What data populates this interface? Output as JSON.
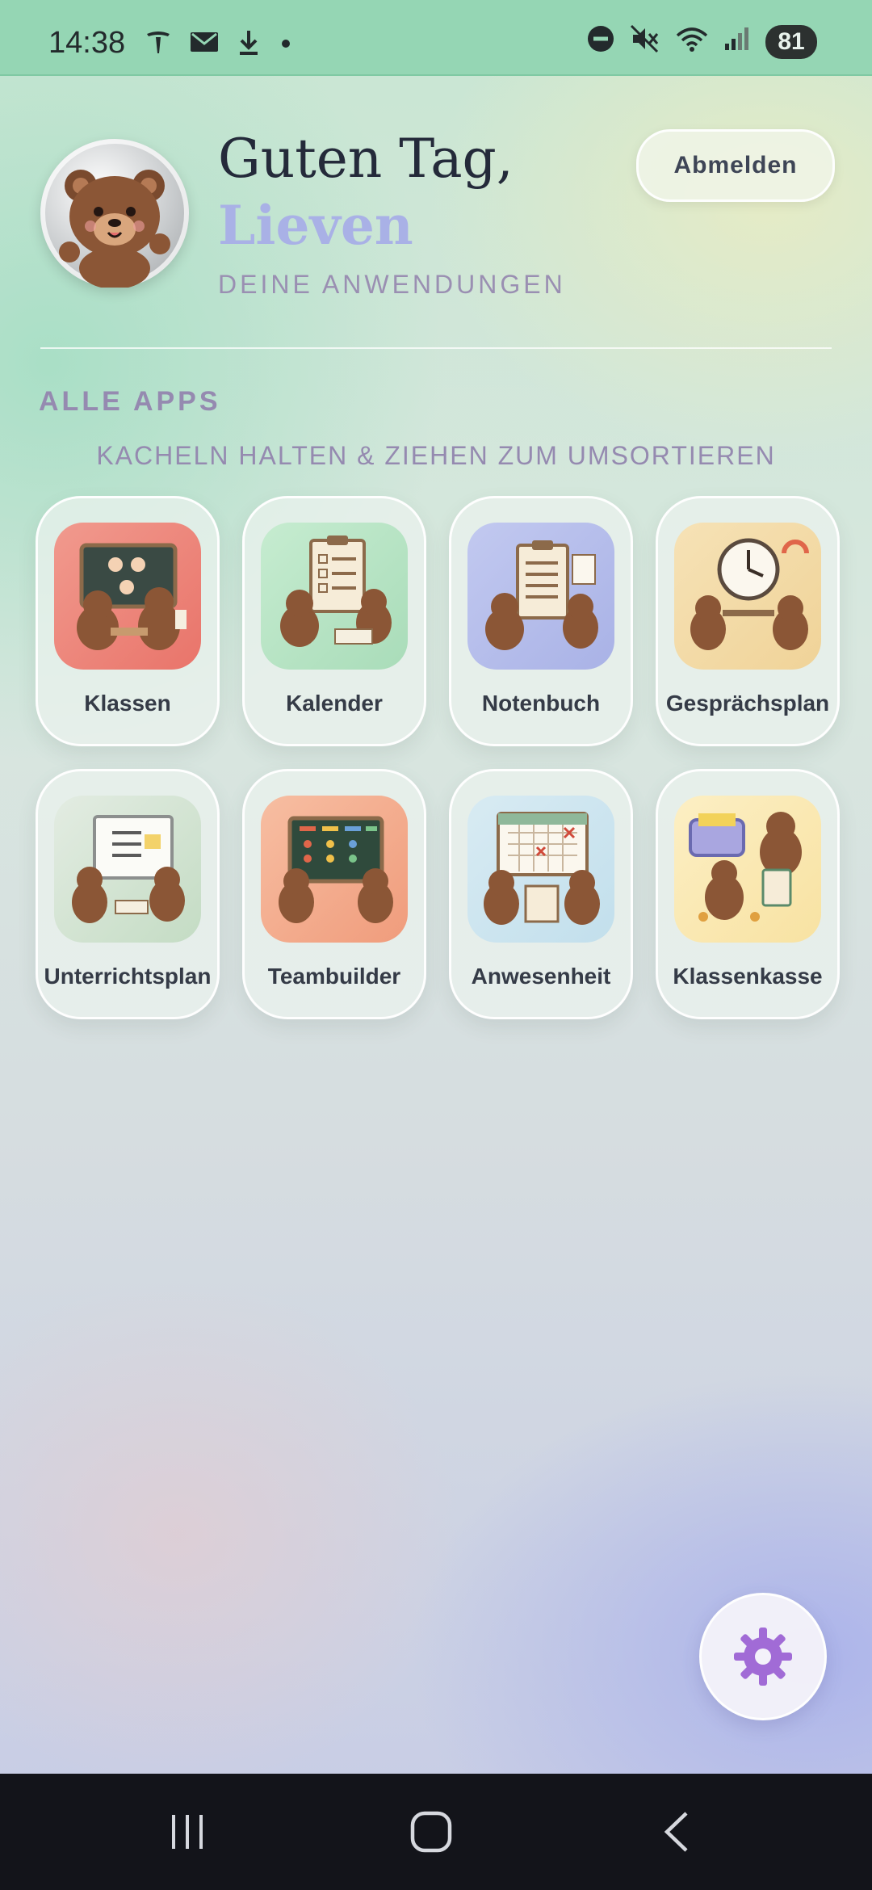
{
  "status_bar": {
    "time": "14:38",
    "battery": "81",
    "left_icons": [
      "tesla-icon",
      "mail-icon",
      "download-icon",
      "dot-icon"
    ],
    "right_icons": [
      "do-not-disturb-icon",
      "mute-icon",
      "wifi-icon",
      "signal-icon"
    ]
  },
  "header": {
    "greeting": "Guten Tag,",
    "username": "Lieven",
    "subtitle": "DEINE ANWENDUNGEN",
    "logout_label": "Abmelden"
  },
  "apps_section": {
    "title": "ALLE APPS",
    "hint": "KACHELN HALTEN & ZIEHEN ZUM UMSORTIEREN",
    "apps": [
      {
        "label": "Klassen",
        "icon": "classroom-bears-icon",
        "color": "#ee8e82"
      },
      {
        "label": "Kalender",
        "icon": "calendar-checklist-bears-icon",
        "color": "#b9e6c6"
      },
      {
        "label": "Notenbuch",
        "icon": "gradebook-bears-icon",
        "color": "#b7bfec"
      },
      {
        "label": "Gesprächsplan",
        "icon": "clock-meeting-bears-icon",
        "color": "#f3dba8"
      },
      {
        "label": "Unterrichtsplan",
        "icon": "whiteboard-bears-icon",
        "color": "#d5e6d3"
      },
      {
        "label": "Teambuilder",
        "icon": "team-board-bears-icon",
        "color": "#f5b396"
      },
      {
        "label": "Anwesenheit",
        "icon": "attendance-calendar-bears-icon",
        "color": "#cfe5f0"
      },
      {
        "label": "Klassenkasse",
        "icon": "treasure-chest-bears-icon",
        "color": "#fbe9b6"
      }
    ]
  },
  "settings_button": {
    "icon": "gear-icon",
    "color": "#a16bd6"
  },
  "nav_bar": {
    "buttons": [
      "recents-icon",
      "home-icon",
      "back-icon"
    ]
  }
}
